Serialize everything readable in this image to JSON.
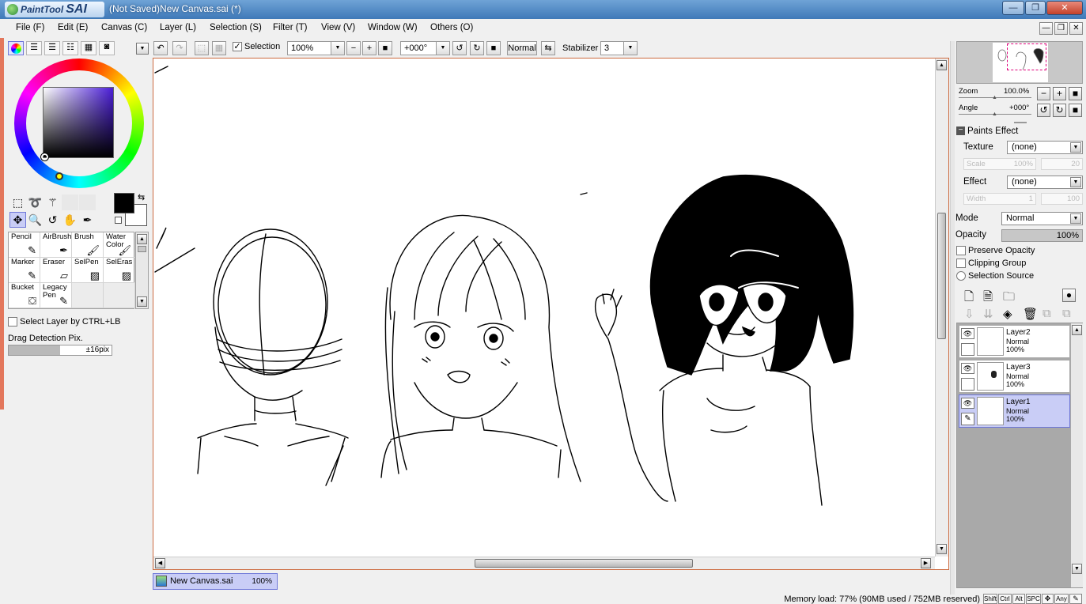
{
  "window": {
    "app_name": "PaintTool",
    "app_name_bold": "SAI",
    "title": "(Not Saved)New Canvas.sai (*)",
    "minimize_label": "—",
    "restore_label": "❐",
    "close_label": "✕"
  },
  "menu": {
    "items": [
      "File (F)",
      "Edit (E)",
      "Canvas (C)",
      "Layer (L)",
      "Selection (S)",
      "Filter (T)",
      "View (V)",
      "Window (W)",
      "Others (O)"
    ],
    "mdi_min": "—",
    "mdi_restore": "❐",
    "mdi_close": "✕"
  },
  "toolbar": {
    "selection_label": "Selection",
    "selection_checked": true,
    "zoom_value": "100%",
    "angle_value": "+000°",
    "blend_mode": "Normal",
    "stabilizer_label": "Stabilizer",
    "stabilizer_value": "3"
  },
  "color": {
    "foreground": "#000000",
    "background": "#ffffff",
    "selected_hue": "#4b1ed8"
  },
  "brushes": [
    {
      "name": "Pencil",
      "icon": "pencil-icon",
      "glyph": "✎"
    },
    {
      "name": "AirBrush",
      "icon": "airbrush-icon",
      "glyph": "✒"
    },
    {
      "name": "Brush",
      "icon": "brush-icon",
      "glyph": "🖌"
    },
    {
      "name": "Water Color",
      "icon": "watercolor-icon",
      "glyph": "🖌"
    },
    {
      "name": "Marker",
      "icon": "marker-icon",
      "glyph": "✎"
    },
    {
      "name": "Eraser",
      "icon": "eraser-icon",
      "glyph": "▱"
    },
    {
      "name": "SelPen",
      "icon": "selpen-icon",
      "glyph": "▨"
    },
    {
      "name": "SelEras",
      "icon": "seleras-icon",
      "glyph": "▨"
    },
    {
      "name": "Bucket",
      "icon": "bucket-icon",
      "glyph": "⛋"
    },
    {
      "name": "Legacy Pen",
      "icon": "legacy-pen-icon",
      "glyph": "✎"
    }
  ],
  "tool_options": {
    "select_layer_label": "Select Layer by CTRL+LB",
    "drag_detection_label": "Drag Detection Pix.",
    "drag_detection_value": "±16pix",
    "drag_detection_fill": 0.5
  },
  "navigator": {
    "zoom_label": "Zoom",
    "zoom_value": "100.0%",
    "angle_label": "Angle",
    "angle_value": "+000°"
  },
  "paints_effect": {
    "header": "Paints Effect",
    "texture_label": "Texture",
    "texture_value": "(none)",
    "scale_label": "Scale",
    "scale_value": "100%",
    "scale_strength": "20",
    "effect_label": "Effect",
    "effect_value": "(none)",
    "width_label": "Width",
    "width_value": "1",
    "width_strength": "100"
  },
  "layer_props": {
    "mode_label": "Mode",
    "mode_value": "Normal",
    "opacity_label": "Opacity",
    "opacity_value": "100%",
    "preserve_opacity": "Preserve Opacity",
    "clipping_group": "Clipping Group",
    "selection_source": "Selection Source"
  },
  "layers": [
    {
      "name": "Layer2",
      "mode": "Normal",
      "opacity": "100%",
      "selected": false
    },
    {
      "name": "Layer3",
      "mode": "Normal",
      "opacity": "100%",
      "selected": false
    },
    {
      "name": "Layer1",
      "mode": "Normal",
      "opacity": "100%",
      "selected": true
    }
  ],
  "document_tab": {
    "name": "New Canvas.sai",
    "zoom": "100%"
  },
  "status": {
    "memory": "Memory load: 77% (90MB used / 752MB reserved)",
    "keys": [
      "Shift",
      "Ctrl",
      "Alt",
      "SPC",
      "✥",
      "Any",
      "✎"
    ]
  }
}
